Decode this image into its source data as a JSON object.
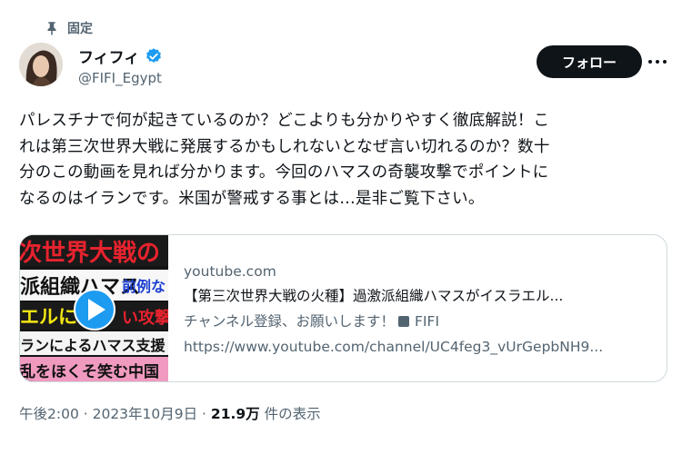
{
  "pinned": {
    "label": "固定",
    "icon": "pin-icon"
  },
  "author": {
    "display_name": "フィフィ",
    "handle": "@FIFI_Egypt",
    "verified": true,
    "verified_color": "#1d9bf0"
  },
  "actions": {
    "follow_label": "フォロー"
  },
  "tweet": {
    "lines": [
      "パレスチナで何が起きているのか？どこよりも分かりやすく徹底解説！こ",
      "れは第三次世界大戦に発展するかもしれないとなぜ言い切れるのか？数十",
      "分のこの動画を見れば分かります。今回のハマスの奇襲攻撃でポイントに",
      "なるのはイランです。米国が警戒する事とは…是非ご覧下さい。"
    ]
  },
  "card": {
    "domain": "youtube.com",
    "title": "【第三次世界大戦の火種】過激派組織ハマスがイスラエル...",
    "desc_prefix": "チャンネル登録、お願いします！",
    "desc_suffix": "FIFI",
    "url": "https://www.youtube.com/channel/UC4feg3_vUrGepbNH9...",
    "thumbnail": {
      "line1": "次世界大戦の",
      "line2": "派組織ハマス",
      "line2_right": "前例な",
      "line3": "エルに",
      "line3_right": "い攻撃",
      "line4": "ランによるハマス支援",
      "line5": "乱をほくそ笑む中国",
      "play_icon": "play-icon"
    }
  },
  "meta": {
    "time": "午後2:00",
    "sep1": " · ",
    "date": "2023年10月9日",
    "sep2": " · ",
    "views": "21.9万",
    "views_suffix": " 件の表示"
  }
}
